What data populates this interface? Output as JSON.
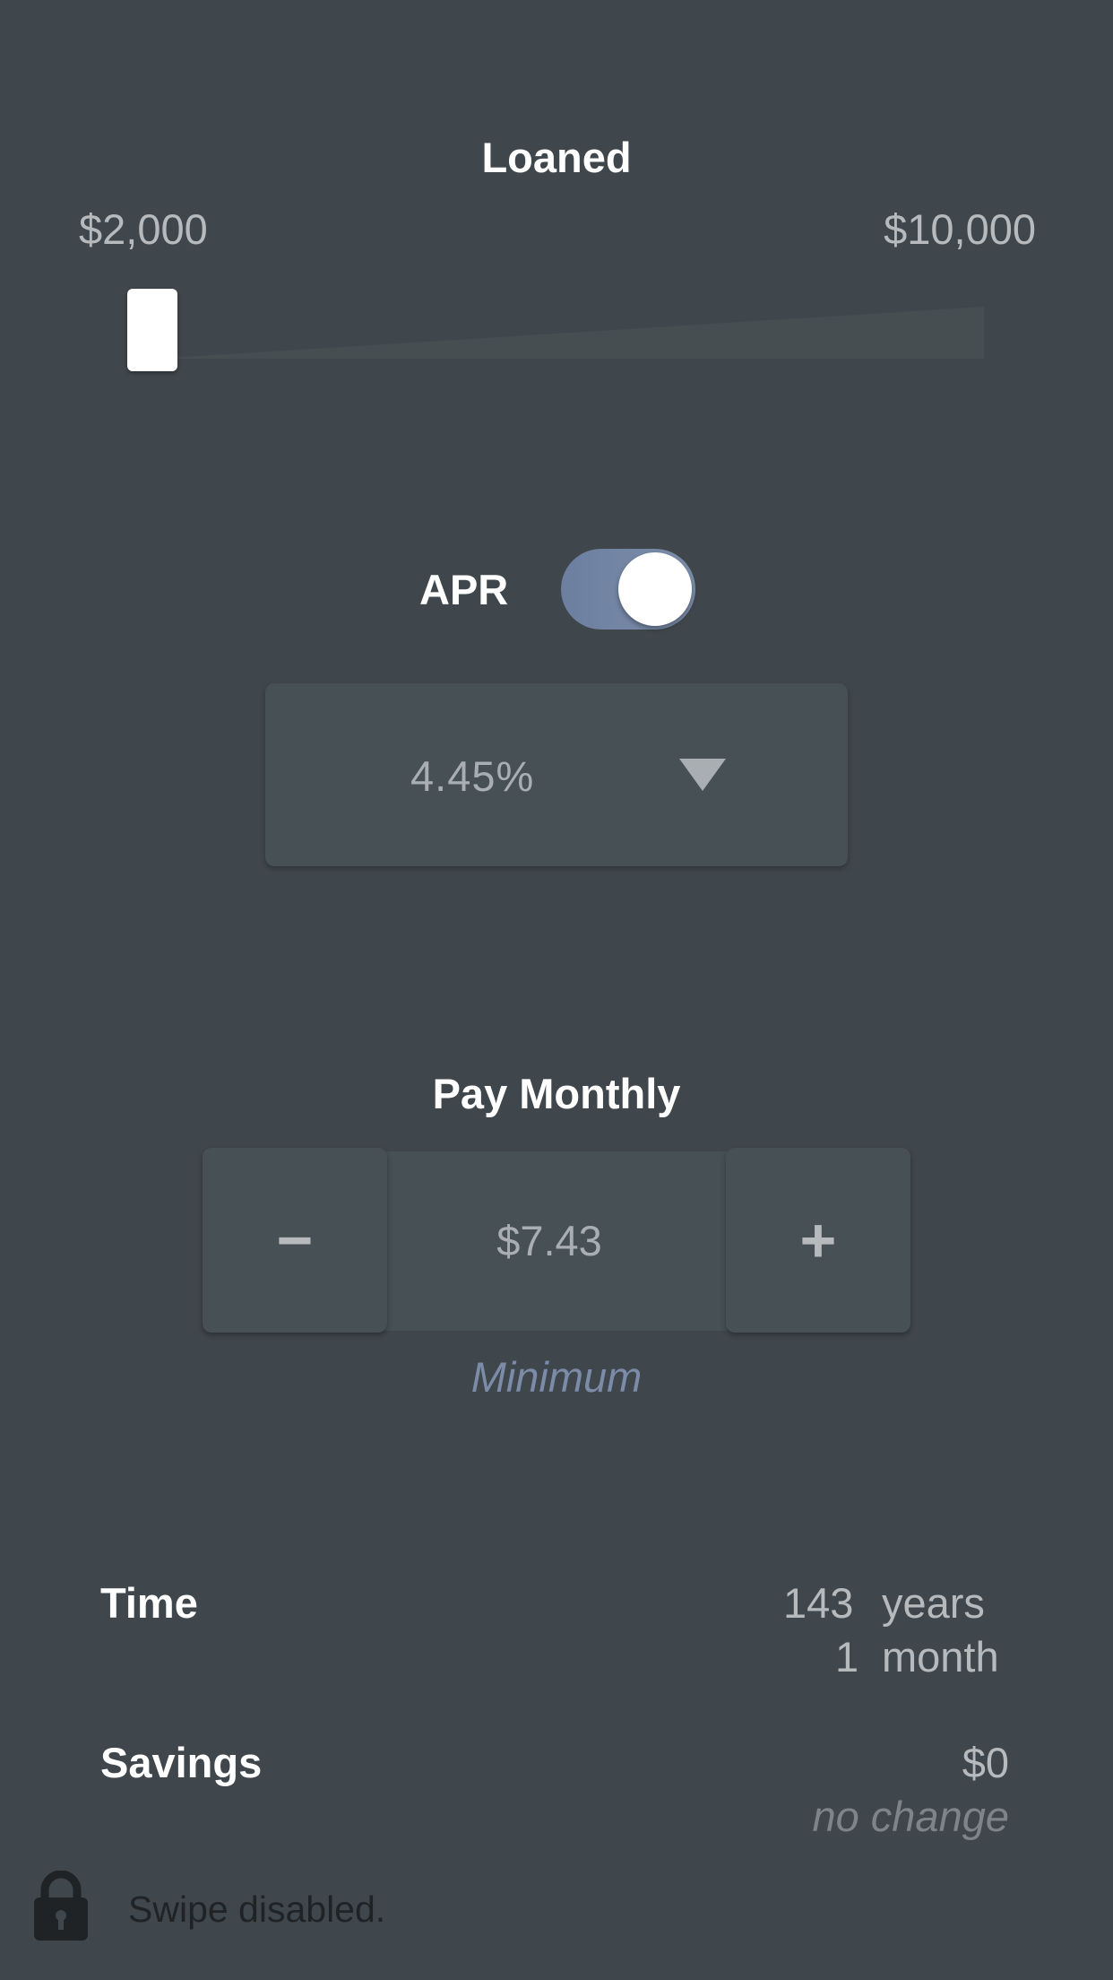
{
  "loaned": {
    "title": "Loaned",
    "min_label": "$2,000",
    "max_label": "$10,000",
    "slider_fraction": 0.0
  },
  "apr": {
    "label": "APR",
    "toggle_on": true,
    "value": "4.45%"
  },
  "pay_monthly": {
    "title": "Pay Monthly",
    "minus_label": "−",
    "plus_label": "+",
    "value": "$7.43",
    "note": "Minimum"
  },
  "results": {
    "time_label": "Time",
    "time_years_num": "143",
    "time_years_unit": "years",
    "time_months_num": "1",
    "time_months_unit": "month",
    "savings_label": "Savings",
    "savings_value": "$0",
    "savings_note": "no change"
  },
  "footer": {
    "icon": "lock-icon",
    "text": "Swipe disabled."
  },
  "colors": {
    "background": "#3f464c",
    "panel": "#465055",
    "accent": "#7c8ca8",
    "toggle": "#6c7fa0"
  }
}
